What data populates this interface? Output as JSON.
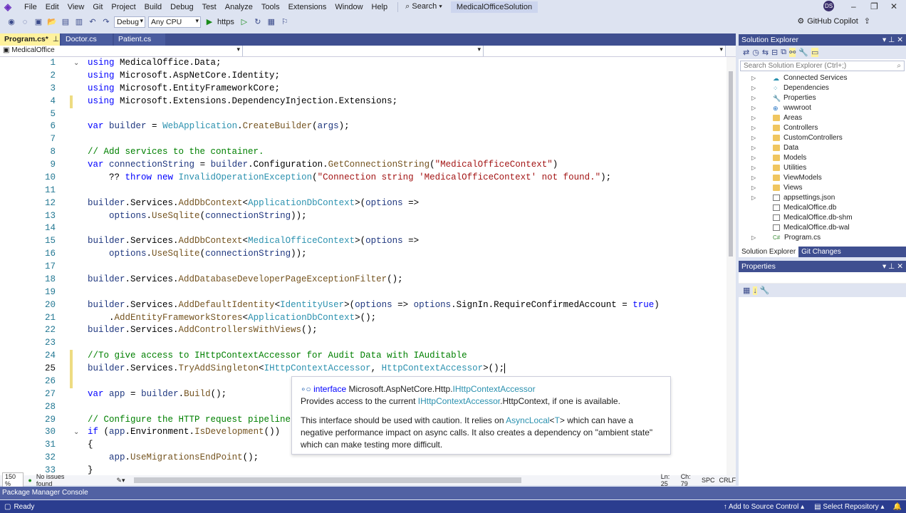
{
  "menu": {
    "items": [
      "File",
      "Edit",
      "View",
      "Git",
      "Project",
      "Build",
      "Debug",
      "Test",
      "Analyze",
      "Tools",
      "Extensions",
      "Window",
      "Help"
    ],
    "search": "Search",
    "solution": "MedicalOfficeSolution",
    "avatar": "DS"
  },
  "toolbar": {
    "config": "Debug",
    "platform": "Any CPU",
    "run": "https",
    "copilot": "GitHub Copilot"
  },
  "tabs": [
    {
      "label": "Program.cs*"
    },
    {
      "label": "Doctor.cs"
    },
    {
      "label": "Patient.cs"
    }
  ],
  "navbar": {
    "project": "MedicalOffice"
  },
  "editor": {
    "current_line": 25,
    "lines": [
      [
        [
          "k",
          "using"
        ],
        [
          "p",
          " MedicalOffice.Data;"
        ]
      ],
      [
        [
          "k",
          "using"
        ],
        [
          "p",
          " Microsoft.AspNetCore.Identity;"
        ]
      ],
      [
        [
          "k",
          "using"
        ],
        [
          "p",
          " Microsoft.EntityFrameworkCore;"
        ]
      ],
      [
        [
          "k",
          "using"
        ],
        [
          "p",
          " Microsoft.Extensions.DependencyInjection.Extensions;"
        ]
      ],
      [],
      [
        [
          "k",
          "var"
        ],
        [
          "p",
          " "
        ],
        [
          "v",
          "builder"
        ],
        [
          "p",
          " = "
        ],
        [
          "t",
          "WebApplication"
        ],
        [
          "p",
          "."
        ],
        [
          "m",
          "CreateBuilder"
        ],
        [
          "p",
          "("
        ],
        [
          "v",
          "args"
        ],
        [
          "p",
          ");"
        ]
      ],
      [],
      [
        [
          "c",
          "// Add services to the container."
        ]
      ],
      [
        [
          "k",
          "var"
        ],
        [
          "p",
          " "
        ],
        [
          "v",
          "connectionString"
        ],
        [
          "p",
          " = "
        ],
        [
          "v",
          "builder"
        ],
        [
          "p",
          ".Configuration."
        ],
        [
          "m",
          "GetConnectionString"
        ],
        [
          "p",
          "("
        ],
        [
          "s",
          "\"MedicalOfficeContext\""
        ],
        [
          "p",
          ")"
        ]
      ],
      [
        [
          "p",
          "    ?? "
        ],
        [
          "k",
          "throw new"
        ],
        [
          "p",
          " "
        ],
        [
          "t",
          "InvalidOperationException"
        ],
        [
          "p",
          "("
        ],
        [
          "s",
          "\"Connection string 'MedicalOfficeContext' not found.\""
        ],
        [
          "p",
          ");"
        ]
      ],
      [],
      [
        [
          "v",
          "builder"
        ],
        [
          "p",
          ".Services."
        ],
        [
          "m",
          "AddDbContext"
        ],
        [
          "p",
          "<"
        ],
        [
          "t",
          "ApplicationDbContext"
        ],
        [
          "p",
          ">("
        ],
        [
          "v",
          "options"
        ],
        [
          "p",
          " =>"
        ]
      ],
      [
        [
          "p",
          "    "
        ],
        [
          "v",
          "options"
        ],
        [
          "p",
          "."
        ],
        [
          "m",
          "UseSqlite"
        ],
        [
          "p",
          "("
        ],
        [
          "v",
          "connectionString"
        ],
        [
          "p",
          "));"
        ]
      ],
      [],
      [
        [
          "v",
          "builder"
        ],
        [
          "p",
          ".Services."
        ],
        [
          "m",
          "AddDbContext"
        ],
        [
          "p",
          "<"
        ],
        [
          "t",
          "MedicalOfficeContext"
        ],
        [
          "p",
          ">("
        ],
        [
          "v",
          "options"
        ],
        [
          "p",
          " =>"
        ]
      ],
      [
        [
          "p",
          "    "
        ],
        [
          "v",
          "options"
        ],
        [
          "p",
          "."
        ],
        [
          "m",
          "UseSqlite"
        ],
        [
          "p",
          "("
        ],
        [
          "v",
          "connectionString"
        ],
        [
          "p",
          "));"
        ]
      ],
      [],
      [
        [
          "v",
          "builder"
        ],
        [
          "p",
          ".Services."
        ],
        [
          "m",
          "AddDatabaseDeveloperPageExceptionFilter"
        ],
        [
          "p",
          "();"
        ]
      ],
      [],
      [
        [
          "v",
          "builder"
        ],
        [
          "p",
          ".Services."
        ],
        [
          "m",
          "AddDefaultIdentity"
        ],
        [
          "p",
          "<"
        ],
        [
          "t",
          "IdentityUser"
        ],
        [
          "p",
          ">("
        ],
        [
          "v",
          "options"
        ],
        [
          "p",
          " => "
        ],
        [
          "v",
          "options"
        ],
        [
          "p",
          ".SignIn.RequireConfirmedAccount = "
        ],
        [
          "k",
          "true"
        ],
        [
          "p",
          ")"
        ]
      ],
      [
        [
          "p",
          "    ."
        ],
        [
          "m",
          "AddEntityFrameworkStores"
        ],
        [
          "p",
          "<"
        ],
        [
          "t",
          "ApplicationDbContext"
        ],
        [
          "p",
          ">();"
        ]
      ],
      [
        [
          "v",
          "builder"
        ],
        [
          "p",
          ".Services."
        ],
        [
          "m",
          "AddControllersWithViews"
        ],
        [
          "p",
          "();"
        ]
      ],
      [],
      [
        [
          "c",
          "//To give access to IHttpContextAccessor for Audit Data with IAuditable"
        ]
      ],
      [
        [
          "v",
          "builder"
        ],
        [
          "p",
          ".Services."
        ],
        [
          "m",
          "TryAddSingleton"
        ],
        [
          "p",
          "<"
        ],
        [
          "t",
          "IHttpContextAccessor"
        ],
        [
          "p",
          ", "
        ],
        [
          "t",
          "HttpContextAccessor"
        ],
        [
          "p",
          ">();"
        ]
      ],
      [],
      [
        [
          "k",
          "var"
        ],
        [
          "p",
          " "
        ],
        [
          "v",
          "app"
        ],
        [
          "p",
          " = "
        ],
        [
          "v",
          "builder"
        ],
        [
          "p",
          "."
        ],
        [
          "m",
          "Build"
        ],
        [
          "p",
          "();"
        ]
      ],
      [],
      [
        [
          "c",
          "// Configure the HTTP request pipeline."
        ]
      ],
      [
        [
          "k",
          "if"
        ],
        [
          "p",
          " ("
        ],
        [
          "v",
          "app"
        ],
        [
          "p",
          ".Environment."
        ],
        [
          "m",
          "IsDevelopment"
        ],
        [
          "p",
          "())"
        ]
      ],
      [
        [
          "p",
          "{"
        ]
      ],
      [
        [
          "p",
          "    "
        ],
        [
          "v",
          "app"
        ],
        [
          "p",
          "."
        ],
        [
          "m",
          "UseMigrationsEndPoint"
        ],
        [
          "p",
          "();"
        ]
      ],
      [
        [
          "p",
          "}"
        ]
      ]
    ]
  },
  "tooltip": {
    "kind": "interface",
    "namespace": "Microsoft.AspNetCore.Http.",
    "name": "IHttpContextAccessor",
    "summary_pre": "Provides access to the current ",
    "summary_link": "IHttpContextAccessor",
    "summary_post": ".HttpContext, if one is available.",
    "remarks_pre": "This interface should be used with caution. It relies on ",
    "remarks_link": "AsyncLocal",
    "remarks_lt": "<",
    "remarks_T": "T",
    "remarks_gt": ">",
    "remarks_post": " which can have a negative performance impact on async calls. It also creates a dependency on \"ambient state\" which can make testing more difficult."
  },
  "editor_status": {
    "zoom": "150 %",
    "issues": "No issues found",
    "ln": "Ln: 25",
    "ch": "Ch: 79",
    "spc": "SPC",
    "eol": "CRLF"
  },
  "solution_explorer": {
    "title": "Solution Explorer",
    "search_placeholder": "Search Solution Explorer (Ctrl+;)",
    "items": [
      {
        "label": "Connected Services",
        "icon": "cloud",
        "expandable": true
      },
      {
        "label": "Dependencies",
        "icon": "dependencies",
        "expandable": true
      },
      {
        "label": "Properties",
        "icon": "properties",
        "expandable": true
      },
      {
        "label": "wwwroot",
        "icon": "globe",
        "expandable": true
      },
      {
        "label": "Areas",
        "icon": "folder",
        "expandable": true
      },
      {
        "label": "Controllers",
        "icon": "folder",
        "expandable": true
      },
      {
        "label": "CustomControllers",
        "icon": "folder",
        "expandable": true
      },
      {
        "label": "Data",
        "icon": "folder",
        "expandable": true
      },
      {
        "label": "Models",
        "icon": "folder",
        "expandable": true
      },
      {
        "label": "Utilities",
        "icon": "folder",
        "expandable": true
      },
      {
        "label": "ViewModels",
        "icon": "folder",
        "expandable": true
      },
      {
        "label": "Views",
        "icon": "folder",
        "expandable": true
      },
      {
        "label": "appsettings.json",
        "icon": "json",
        "expandable": true
      },
      {
        "label": "MedicalOffice.db",
        "icon": "file",
        "expandable": false
      },
      {
        "label": "MedicalOffice.db-shm",
        "icon": "file",
        "expandable": false
      },
      {
        "label": "MedicalOffice.db-wal",
        "icon": "file",
        "expandable": false
      },
      {
        "label": "Program.cs",
        "icon": "csharp",
        "expandable": true
      }
    ],
    "tabs": [
      "Solution Explorer",
      "Git Changes"
    ]
  },
  "properties": {
    "title": "Properties"
  },
  "bottom": {
    "pmc": "Package Manager Console",
    "ready": "Ready",
    "source_control": "Add to Source Control",
    "repo": "Select Repository"
  }
}
